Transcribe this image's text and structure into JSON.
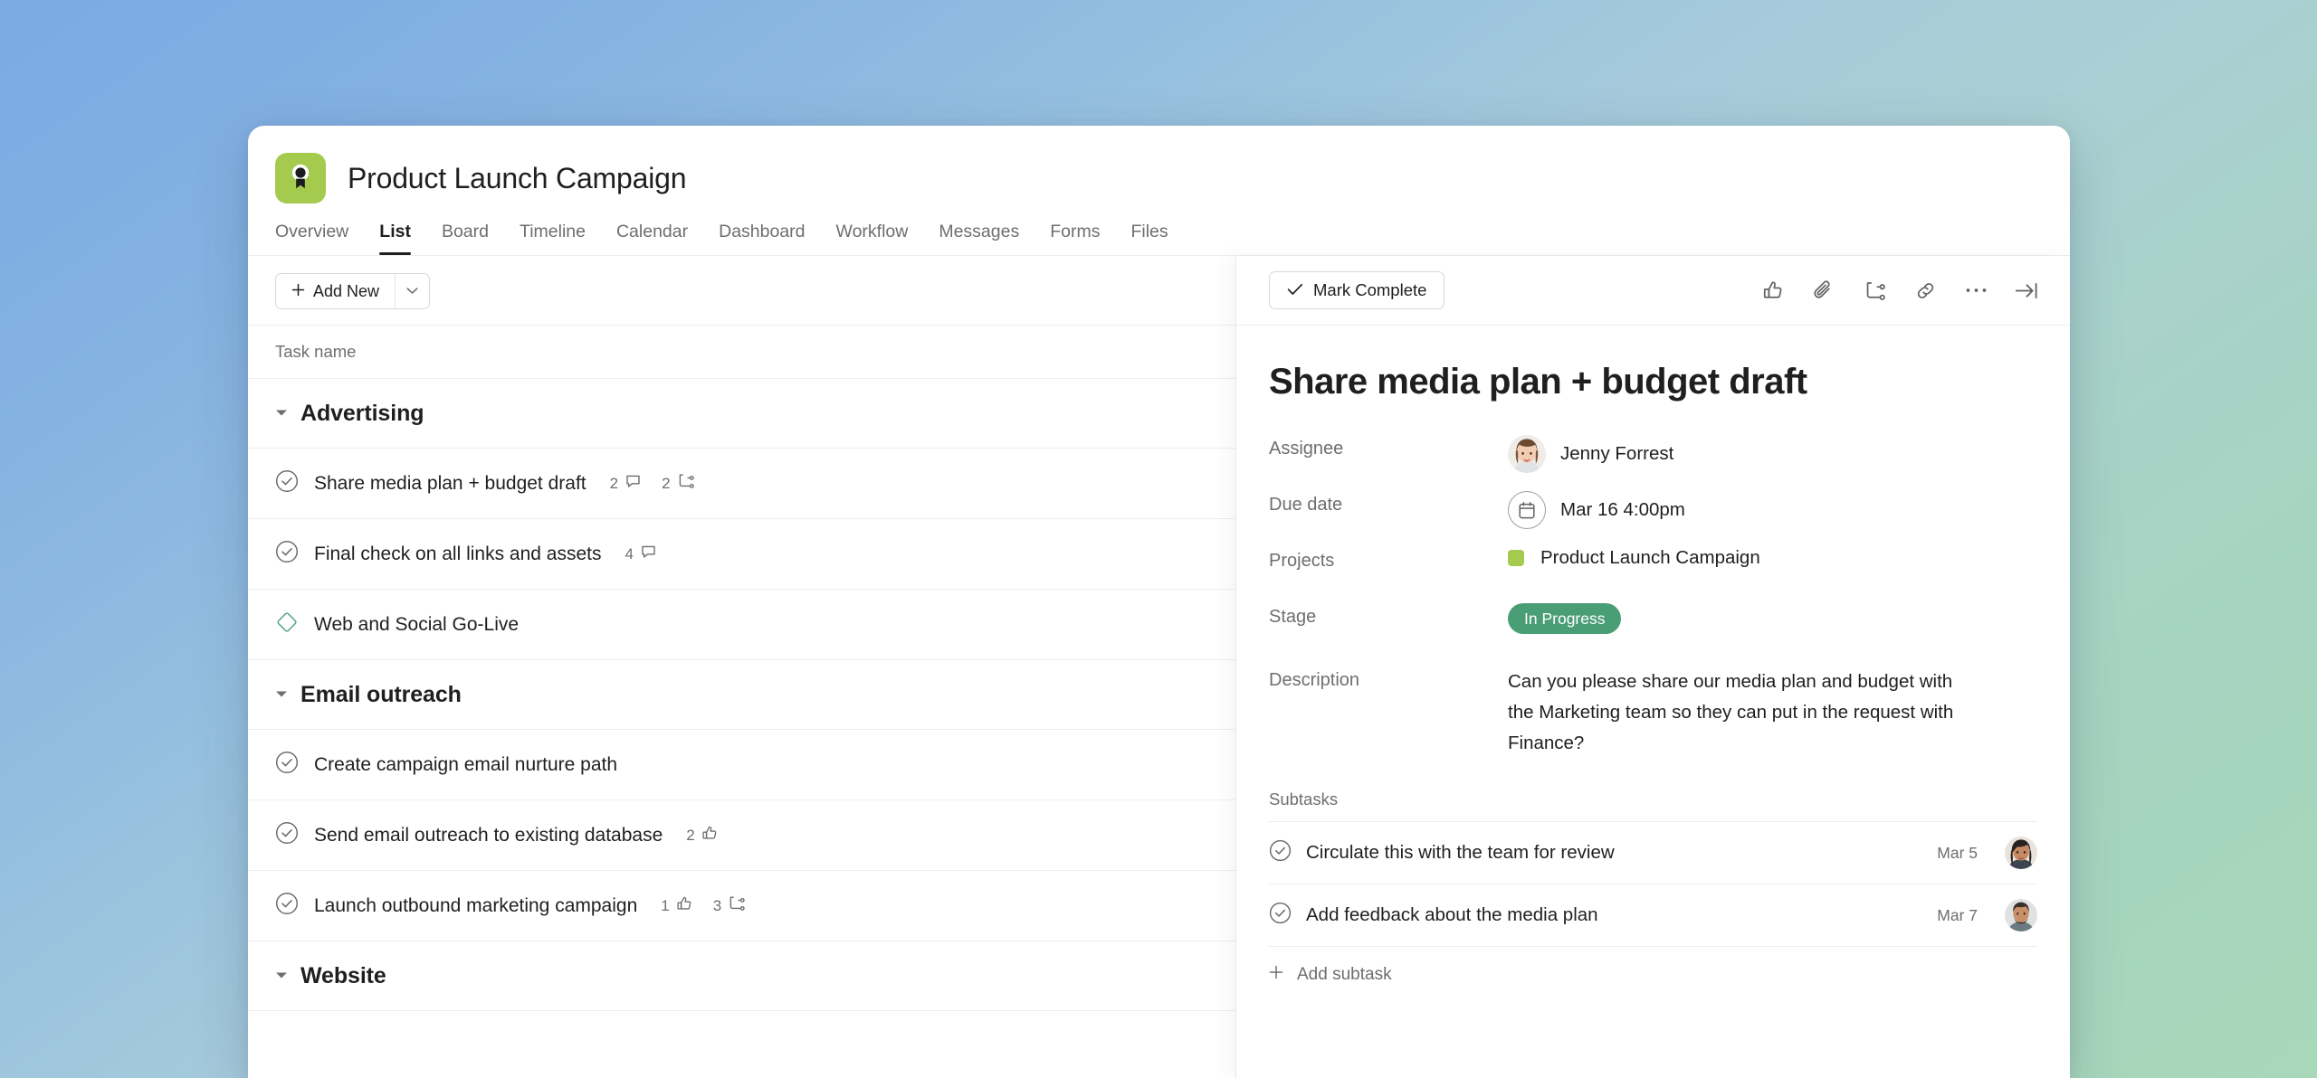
{
  "app": {
    "project_title": "Product Launch Campaign",
    "logo_color": "#a4ca4e",
    "logo_icon": "award-ribbon-icon"
  },
  "tabs": [
    {
      "label": "Overview",
      "active": false
    },
    {
      "label": "List",
      "active": true
    },
    {
      "label": "Board",
      "active": false
    },
    {
      "label": "Timeline",
      "active": false
    },
    {
      "label": "Calendar",
      "active": false
    },
    {
      "label": "Dashboard",
      "active": false
    },
    {
      "label": "Workflow",
      "active": false
    },
    {
      "label": "Messages",
      "active": false
    },
    {
      "label": "Forms",
      "active": false
    },
    {
      "label": "Files",
      "active": false
    }
  ],
  "list_pane": {
    "add_new_label": "Add New",
    "column_header": "Task name",
    "sections": [
      {
        "title": "Advertising",
        "tasks": [
          {
            "name": "Share media plan + budget draft",
            "icon": "check-circle-icon",
            "badges": [
              {
                "count": "2",
                "icon": "comment-icon"
              },
              {
                "count": "2",
                "icon": "subtask-icon"
              }
            ]
          },
          {
            "name": "Final check on all links and assets",
            "icon": "check-circle-icon",
            "badges": [
              {
                "count": "4",
                "icon": "comment-icon"
              }
            ]
          },
          {
            "name": "Web and Social Go-Live",
            "icon": "milestone-diamond-icon",
            "badges": []
          }
        ]
      },
      {
        "title": "Email outreach",
        "tasks": [
          {
            "name": "Create campaign email nurture path",
            "icon": "check-circle-icon",
            "badges": []
          },
          {
            "name": "Send email outreach to existing database",
            "icon": "check-circle-icon",
            "badges": [
              {
                "count": "2",
                "icon": "thumbs-up-icon"
              }
            ]
          },
          {
            "name": "Launch outbound marketing campaign",
            "icon": "check-circle-icon",
            "badges": [
              {
                "count": "1",
                "icon": "thumbs-up-icon"
              },
              {
                "count": "3",
                "icon": "subtask-icon"
              }
            ]
          }
        ]
      },
      {
        "title": "Website",
        "tasks": []
      }
    ]
  },
  "detail_pane": {
    "mark_complete_label": "Mark Complete",
    "actions": [
      "thumbs-up-icon",
      "paperclip-icon",
      "subtask-icon",
      "link-icon",
      "ellipsis-icon",
      "collapse-panel-icon"
    ],
    "task_title": "Share media plan + budget draft",
    "fields": {
      "assignee_label": "Assignee",
      "assignee_value": "Jenny Forrest",
      "due_date_label": "Due date",
      "due_date_value": "Mar 16 4:00pm",
      "projects_label": "Projects",
      "projects_value": "Product Launch Campaign",
      "projects_swatch_color": "#a4ca4e",
      "stage_label": "Stage",
      "stage_value": "In Progress",
      "stage_color": "#4a9e76",
      "description_label": "Description",
      "description_value": "Can you please share our media plan and budget with the Marketing team so they can put in the request with Finance?"
    },
    "subtasks_label": "Subtasks",
    "subtasks": [
      {
        "name": "Circulate this with the team for review",
        "date": "Mar 5",
        "icon": "check-circle-icon"
      },
      {
        "name": "Add feedback about the media plan",
        "date": "Mar 7",
        "icon": "check-circle-icon"
      }
    ],
    "add_subtask_label": "Add subtask"
  }
}
